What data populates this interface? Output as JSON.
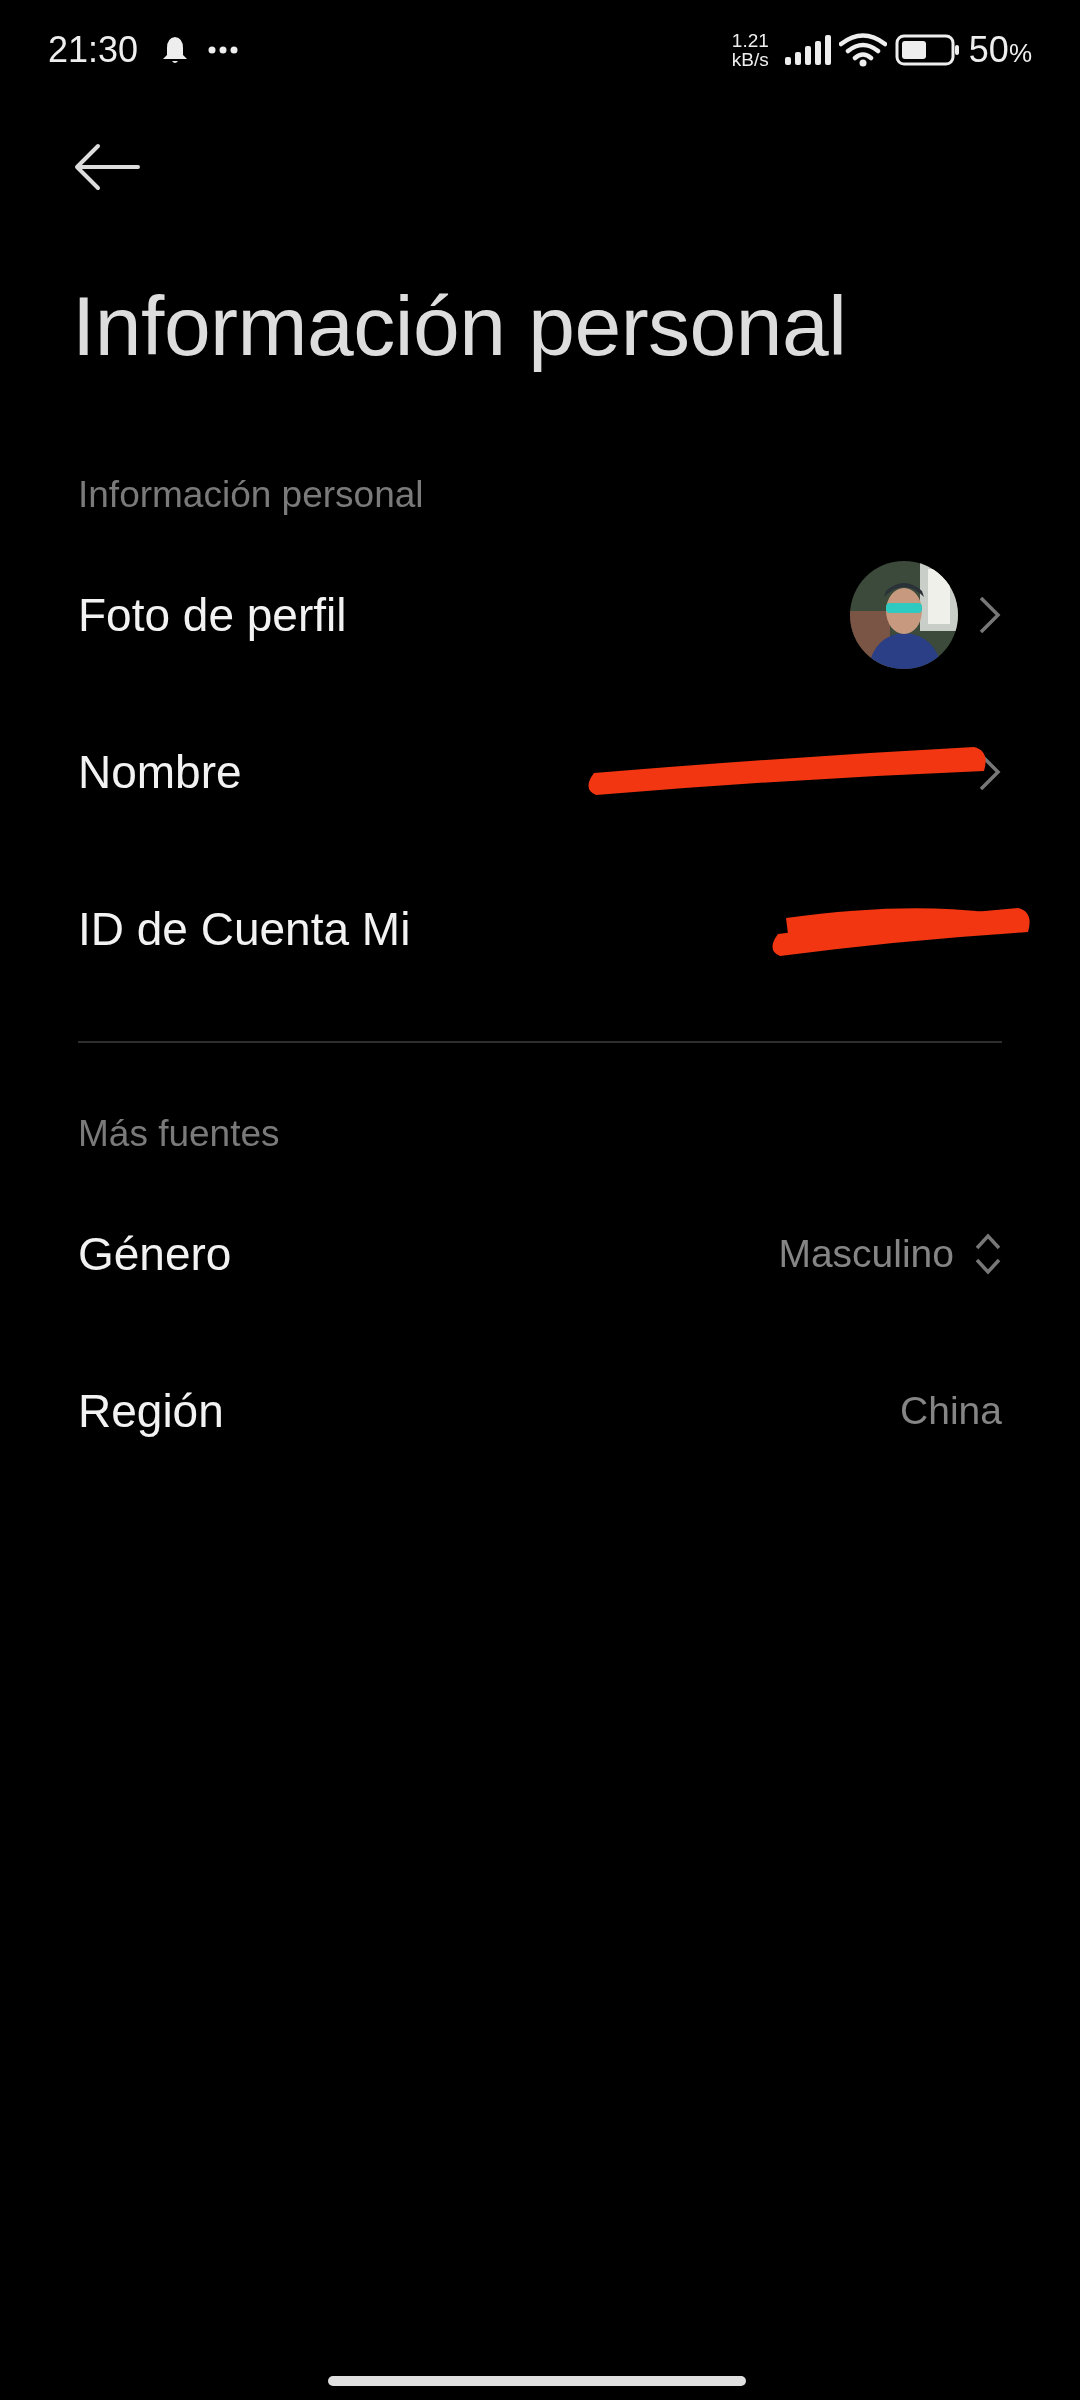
{
  "status_bar": {
    "time": "21:30",
    "network_speed": "1.21",
    "network_speed_unit": "kB/s",
    "battery": "50",
    "battery_unit": "%"
  },
  "title": "Información personal",
  "sections": [
    {
      "header": "Información personal",
      "rows": [
        {
          "kind": "avatar",
          "label": "Foto de perfil",
          "chevron": true
        },
        {
          "kind": "redacted",
          "label": "Nombre",
          "chevron": true
        },
        {
          "kind": "redacted",
          "label": "ID de Cuenta Mi",
          "chevron": false
        }
      ]
    },
    {
      "header": "Más fuentes",
      "rows": [
        {
          "kind": "picker",
          "label": "Género",
          "value": "Masculino"
        },
        {
          "kind": "text",
          "label": "Región",
          "value": "China"
        }
      ]
    }
  ]
}
